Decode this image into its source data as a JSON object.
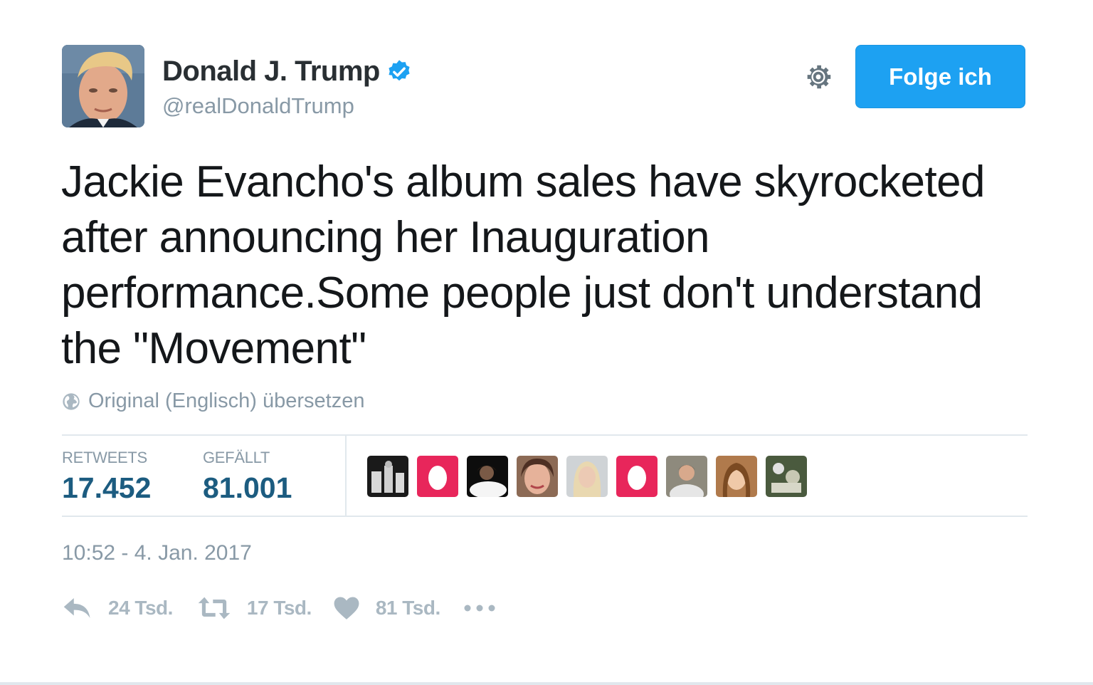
{
  "user": {
    "name": "Donald J. Trump",
    "handle": "@realDonaldTrump",
    "verified": true
  },
  "header": {
    "follow_label": "Folge ich",
    "gear_icon": "gear-icon"
  },
  "tweet": {
    "lines": [
      "Jackie Evancho's album sales have skyrocketed",
      "after announcing her Inauguration",
      "performance.Some people just don't understand",
      "the \"Movement\""
    ],
    "translate_label": "Original (Englisch) übersetzen"
  },
  "stats": {
    "retweets_label": "RETWEETS",
    "retweets_value": "17.452",
    "likes_label": "GEFÄLLT",
    "likes_value": "81.001",
    "likers": [
      "avatar",
      "egg",
      "avatar",
      "avatar",
      "avatar",
      "egg",
      "avatar",
      "avatar",
      "avatar"
    ]
  },
  "timestamp": "10:52 - 4. Jan. 2017",
  "actions": {
    "reply_count": "24 Tsd.",
    "retweet_count": "17 Tsd.",
    "like_count": "81 Tsd."
  },
  "colors": {
    "accent": "#1da1f2",
    "stat_value": "#1c5c80",
    "muted": "#8899a6",
    "egg_bg": "#e8265b"
  }
}
